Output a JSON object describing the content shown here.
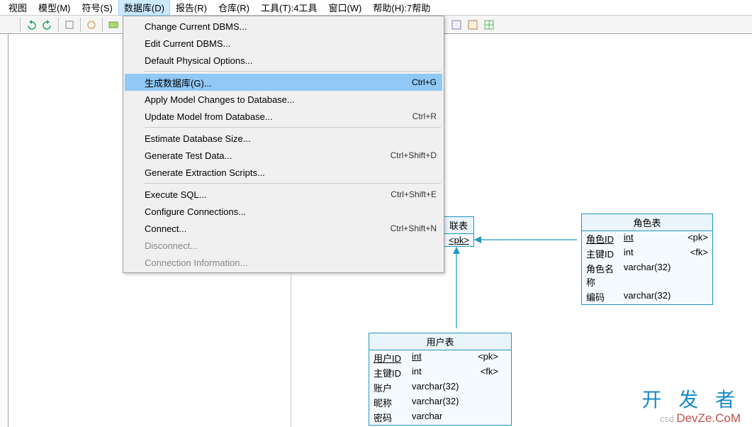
{
  "menubar": [
    {
      "label": "视图",
      "key": ""
    },
    {
      "label": "模型",
      "key": "(M)"
    },
    {
      "label": "符号",
      "key": "(S)"
    },
    {
      "label": "数据库",
      "key": "(D)",
      "active": true
    },
    {
      "label": "报告",
      "key": "(R)"
    },
    {
      "label": "仓库",
      "key": "(R)"
    },
    {
      "label": "工具",
      "key": "(T):4工具"
    },
    {
      "label": "窗口",
      "key": "(W)"
    },
    {
      "label": "帮助",
      "key": "(H):7帮助"
    }
  ],
  "dropdown": [
    {
      "type": "item",
      "label": "Change Current DBMS..."
    },
    {
      "type": "item",
      "label": "Edit Current DBMS..."
    },
    {
      "type": "item",
      "label": "Default Physical Options..."
    },
    {
      "type": "sep"
    },
    {
      "type": "item",
      "label": "生成数据库(G)...",
      "shortcut": "Ctrl+G",
      "hl": true
    },
    {
      "type": "item",
      "label": "Apply Model Changes to Database..."
    },
    {
      "type": "item",
      "label": "Update Model from Database...",
      "shortcut": "Ctrl+R"
    },
    {
      "type": "sep"
    },
    {
      "type": "item",
      "label": "Estimate Database Size..."
    },
    {
      "type": "item",
      "label": "Generate Test Data...",
      "shortcut": "Ctrl+Shift+D"
    },
    {
      "type": "item",
      "label": "Generate Extraction Scripts..."
    },
    {
      "type": "sep"
    },
    {
      "type": "item",
      "label": "Execute SQL...",
      "shortcut": "Ctrl+Shift+E"
    },
    {
      "type": "item",
      "label": "Configure Connections..."
    },
    {
      "type": "item",
      "label": "Connect...",
      "shortcut": "Ctrl+Shift+N"
    },
    {
      "type": "item",
      "label": "Disconnect...",
      "disabled": true
    },
    {
      "type": "item",
      "label": "Connection Information...",
      "disabled": true
    }
  ],
  "peek_entity": {
    "title": "联表",
    "key_suffix": "<pk>"
  },
  "entity_role": {
    "title": "角色表",
    "rows": [
      {
        "c1": "角色ID",
        "c2": "int",
        "c3": "<pk>",
        "pk": true
      },
      {
        "c1": "主键ID",
        "c2": "int",
        "c3": "<fk>"
      },
      {
        "c1": "角色名称",
        "c2": "varchar(32)"
      },
      {
        "c1": "编码",
        "c2": "varchar(32)"
      }
    ]
  },
  "entity_user": {
    "title": "用户表",
    "rows": [
      {
        "c1": "用户ID",
        "c2": "int",
        "c3": "<pk>",
        "pk": true
      },
      {
        "c1": "主键ID",
        "c2": "int",
        "c3": "<fk>"
      },
      {
        "c1": "账户",
        "c2": "varchar(32)"
      },
      {
        "c1": "昵称",
        "c2": "varchar(32)"
      },
      {
        "c1": "密码",
        "c2": "varchar"
      }
    ]
  },
  "watermark": {
    "big": "开 发 者",
    "sub": "DevZe.CoM",
    "csdn": "csd"
  }
}
